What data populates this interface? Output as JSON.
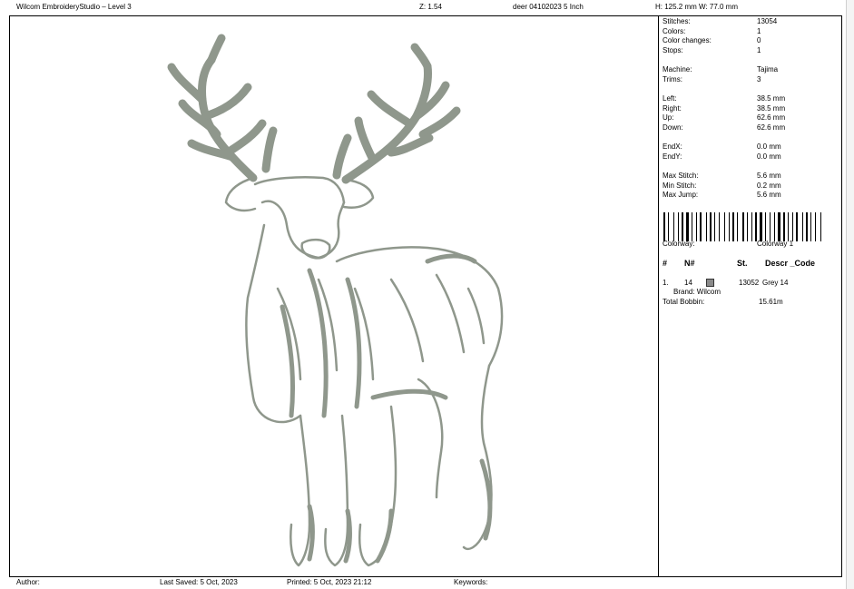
{
  "header": {
    "app_title": "Wilcom EmbroideryStudio – Level 3",
    "zoom": "Z: 1.54",
    "file_name": "deer 04102023 5 Inch",
    "dimensions": "H: 125.2 mm   W: 77.0 mm"
  },
  "stats": [
    {
      "label": "Stitches:",
      "value": "13054"
    },
    {
      "label": "Colors:",
      "value": "1"
    },
    {
      "label": "Color changes:",
      "value": "0"
    },
    {
      "label": "Stops:",
      "value": "1"
    },
    {
      "label": "Machine:",
      "value": "Tajima"
    },
    {
      "label": "Trims:",
      "value": "3"
    },
    {
      "label": "Left:",
      "value": "38.5 mm"
    },
    {
      "label": "Right:",
      "value": "38.5 mm"
    },
    {
      "label": "Up:",
      "value": "62.6 mm"
    },
    {
      "label": "Down:",
      "value": "62.6 mm"
    },
    {
      "label": "EndX:",
      "value": "0.0 mm"
    },
    {
      "label": "EndY:",
      "value": "0.0 mm"
    },
    {
      "label": "Max Stitch:",
      "value": "5.6 mm"
    },
    {
      "label": "Min Stitch:",
      "value": "0.2 mm"
    },
    {
      "label": "Max Jump:",
      "value": "5.6 mm"
    }
  ],
  "colorway": {
    "label": "Colorway:",
    "value": "Colorway 1"
  },
  "color_table": {
    "headers": {
      "num": "#",
      "n": "N#",
      "st": "St.",
      "descr": "Descr _Code"
    },
    "rows": [
      {
        "index": "1.",
        "n": "14",
        "stitches": "13052",
        "description": "Grey 14",
        "brand": "Brand: Wilcom",
        "color": "#8a8a8a"
      }
    ]
  },
  "total_bobbin": {
    "label": "Total Bobbin:",
    "value": "15.61m"
  },
  "footer": {
    "author": "Author:",
    "last_saved": "Last Saved:  5 Oct, 2023",
    "printed": "Printed:  5 Oct, 2023 21:12",
    "keywords": "Keywords:"
  },
  "design": {
    "thread_color": "#8f978c",
    "subject": "deer"
  }
}
